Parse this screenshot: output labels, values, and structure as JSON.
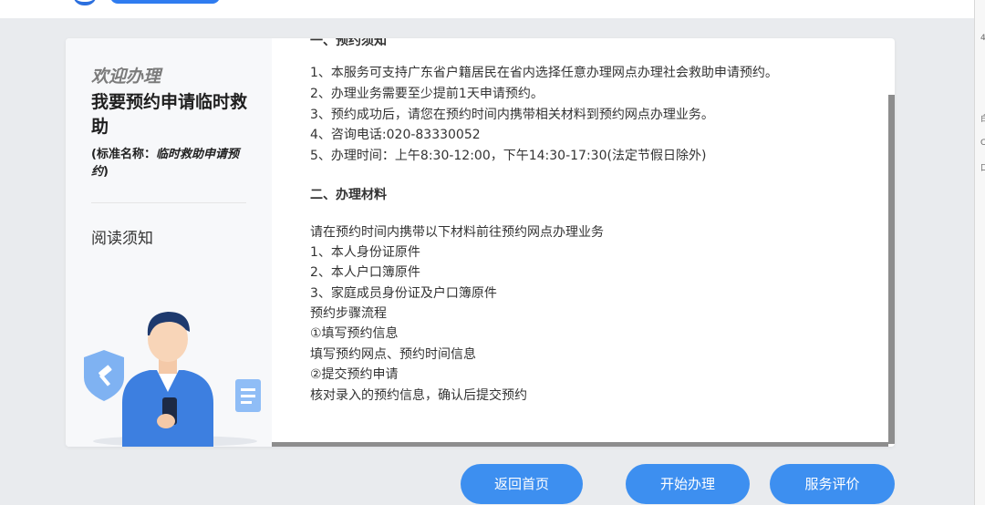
{
  "header": {},
  "sidebar": {
    "welcome": "欢迎办理",
    "service_title": "我要预约申请临时救助",
    "std_name_prefix": "(标准名称：",
    "std_name_value": "临时救助申请预约",
    "std_name_suffix": ")",
    "nav_read": "阅读须知"
  },
  "content": {
    "section1_heading": "一、预约须知",
    "section1_lines": [
      "1、本服务可支持广东省户籍居民在省内选择任意办理网点办理社会救助申请预约。",
      "2、办理业务需要至少提前1天申请预约。",
      "3、预约成功后，请您在预约时间内携带相关材料到预约网点办理业务。",
      "4、咨询电话:020-83330052",
      "5、办理时间：上午8:30-12:00，下午14:30-17:30(法定节假日除外)"
    ],
    "section2_heading": "二、办理材料",
    "section2_lines": [
      "请在预约时间内携带以下材料前往预约网点办理业务",
      "1、本人身份证原件",
      "2、本人户口簿原件",
      "3、家庭成员身份证及户口簿原件",
      "预约步骤流程",
      "①填写预约信息",
      "填写预约网点、预约时间信息",
      "②提交预约申请",
      "核对录入的预约信息，确认后提交预约"
    ]
  },
  "buttons": {
    "home": "返回首页",
    "start": "开始办理",
    "evaluate": "服务评价"
  },
  "right_strip_chars": [
    "4",
    "白",
    "C",
    "口"
  ],
  "colors": {
    "accent": "#3d8ff0",
    "background": "#e9ebee",
    "card": "#ffffff",
    "sidebar": "#f7f8fa"
  }
}
